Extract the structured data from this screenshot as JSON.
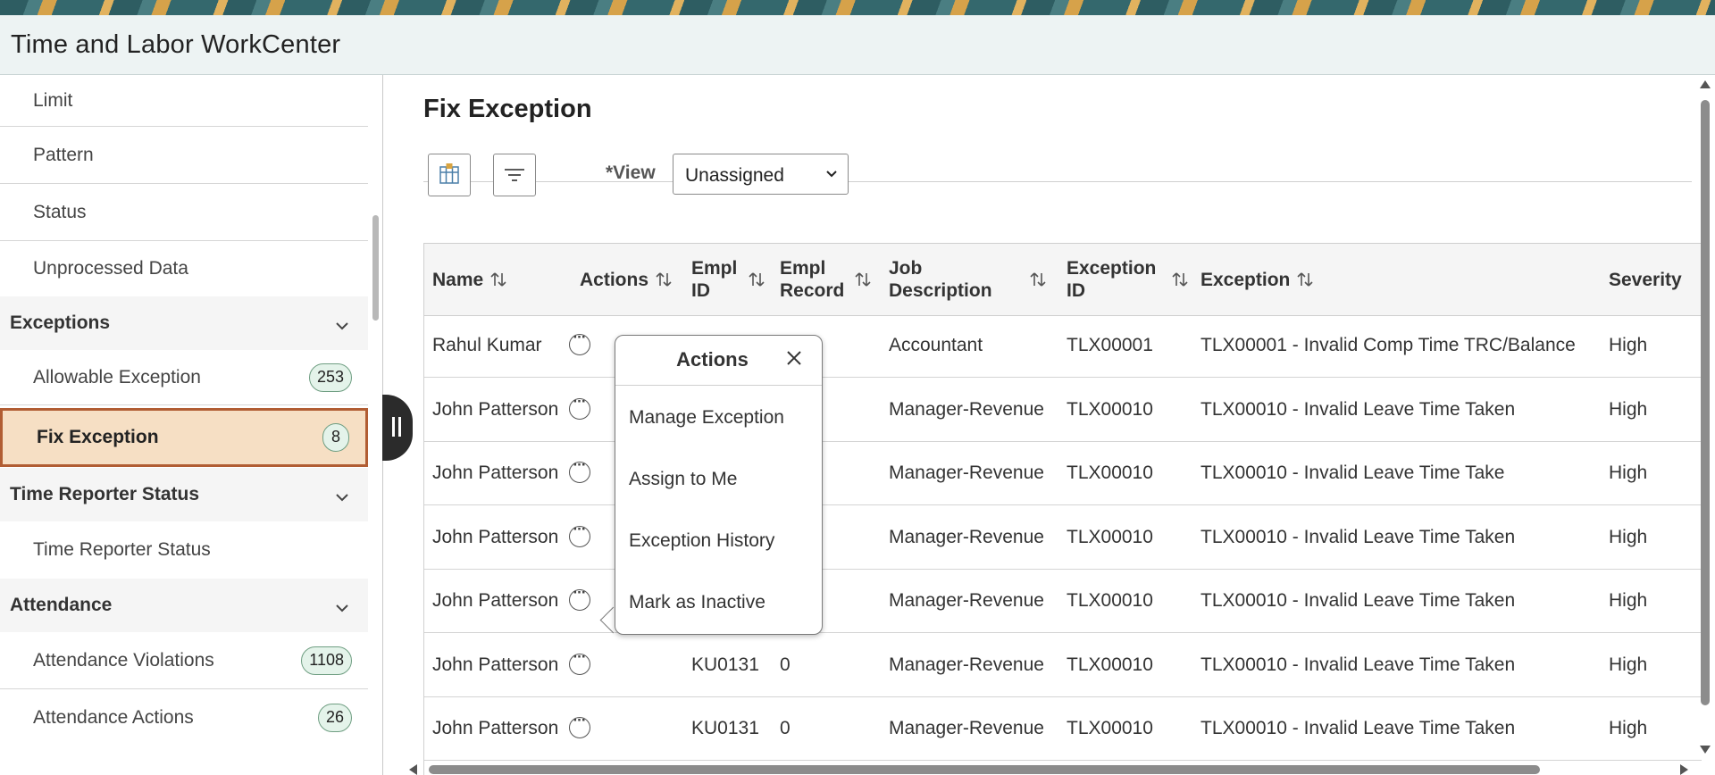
{
  "app": {
    "title": "Time and Labor WorkCenter"
  },
  "sidebar": {
    "items_top": [
      {
        "label": "Limit"
      },
      {
        "label": "Pattern"
      },
      {
        "label": "Status"
      },
      {
        "label": "Unprocessed Data"
      }
    ],
    "sections": [
      {
        "title": "Exceptions",
        "items": [
          {
            "label": "Allowable Exception",
            "badge": "253"
          },
          {
            "label": "Fix Exception",
            "badge": "8",
            "selected": true
          }
        ]
      },
      {
        "title": "Time Reporter Status",
        "items": [
          {
            "label": "Time Reporter Status"
          }
        ]
      },
      {
        "title": "Attendance",
        "items": [
          {
            "label": "Attendance Violations",
            "badge": "1108"
          },
          {
            "label": "Attendance Actions",
            "badge": "26"
          }
        ]
      }
    ]
  },
  "main": {
    "page_title": "Fix Exception",
    "view": {
      "label": "*View",
      "value": "Unassigned"
    },
    "columns": [
      "Name",
      "Actions",
      "Empl ID",
      "Empl Record",
      "Job Description",
      "Exception ID",
      "Exception",
      "Severity"
    ],
    "rows": [
      {
        "name": "Rahul Kumar",
        "empl_id": "",
        "empl_record": "",
        "job": "Accountant",
        "exc_id": "TLX00001",
        "exception": "TLX00001 - Invalid Comp Time TRC/Balance",
        "severity": "High"
      },
      {
        "name": "John Patterson",
        "empl_id": "",
        "empl_record": "",
        "job": "Manager-Revenue",
        "exc_id": "TLX00010",
        "exception": "TLX00010 - Invalid Leave Time Taken",
        "severity": "High"
      },
      {
        "name": "John Patterson",
        "empl_id": "",
        "empl_record": "",
        "job": "Manager-Revenue",
        "exc_id": "TLX00010",
        "exception": "TLX00010 - Invalid Leave Time Take",
        "severity": "High"
      },
      {
        "name": "John Patterson",
        "empl_id": "",
        "empl_record": "",
        "job": "Manager-Revenue",
        "exc_id": "TLX00010",
        "exception": "TLX00010 - Invalid Leave Time Taken",
        "severity": "High"
      },
      {
        "name": "John Patterson",
        "empl_id": "",
        "empl_record": "",
        "job": "Manager-Revenue",
        "exc_id": "TLX00010",
        "exception": "TLX00010 - Invalid Leave Time Taken",
        "severity": "High"
      },
      {
        "name": "John Patterson",
        "empl_id": "KU0131",
        "empl_record": "0",
        "job": "Manager-Revenue",
        "exc_id": "TLX00010",
        "exception": "TLX00010 - Invalid Leave Time Taken",
        "severity": "High"
      },
      {
        "name": "John Patterson",
        "empl_id": "KU0131",
        "empl_record": "0",
        "job": "Manager-Revenue",
        "exc_id": "TLX00010",
        "exception": "TLX00010 - Invalid Leave Time Taken",
        "severity": "High"
      }
    ]
  },
  "popover": {
    "title": "Actions",
    "items": [
      "Manage Exception",
      "Assign to Me",
      "Exception History",
      "Mark as Inactive"
    ]
  }
}
